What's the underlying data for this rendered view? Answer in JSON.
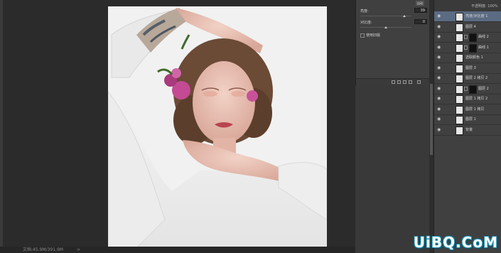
{
  "statusbar": {
    "doc_info": "文档:45.9M/391.9M",
    "arrow": ">"
  },
  "adjustments": {
    "button": "自动",
    "hue_label": "亮度:",
    "hue_value": "39",
    "contrast_label": "对比度:",
    "contrast_value": "0",
    "legacy_label": "使用旧版"
  },
  "layers": {
    "header": "不透明度: 100%",
    "items": [
      {
        "name": "亮度/对比度 1",
        "selected": true,
        "mask": false
      },
      {
        "name": "图层 4",
        "selected": false,
        "mask": false
      },
      {
        "name": "曲线 2",
        "selected": false,
        "mask": true
      },
      {
        "name": "曲线 1",
        "selected": false,
        "mask": true
      },
      {
        "name": "选取颜色 1",
        "selected": false,
        "mask": false
      },
      {
        "name": "图层 3",
        "selected": false,
        "mask": false
      },
      {
        "name": "图层 2 拷贝 2",
        "selected": false,
        "mask": false
      },
      {
        "name": "图层 2",
        "selected": false,
        "mask": true
      },
      {
        "name": "图层 1 拷贝 2",
        "selected": false,
        "mask": false
      },
      {
        "name": "图层 1 拷贝",
        "selected": false,
        "mask": false
      },
      {
        "name": "图层 1",
        "selected": false,
        "mask": false
      },
      {
        "name": "背景",
        "selected": false,
        "mask": false
      }
    ]
  },
  "watermark": {
    "text": "UiBQ.CoM"
  },
  "colors": {
    "accent": "#1a8fb0",
    "selection": "#5a6b82"
  }
}
